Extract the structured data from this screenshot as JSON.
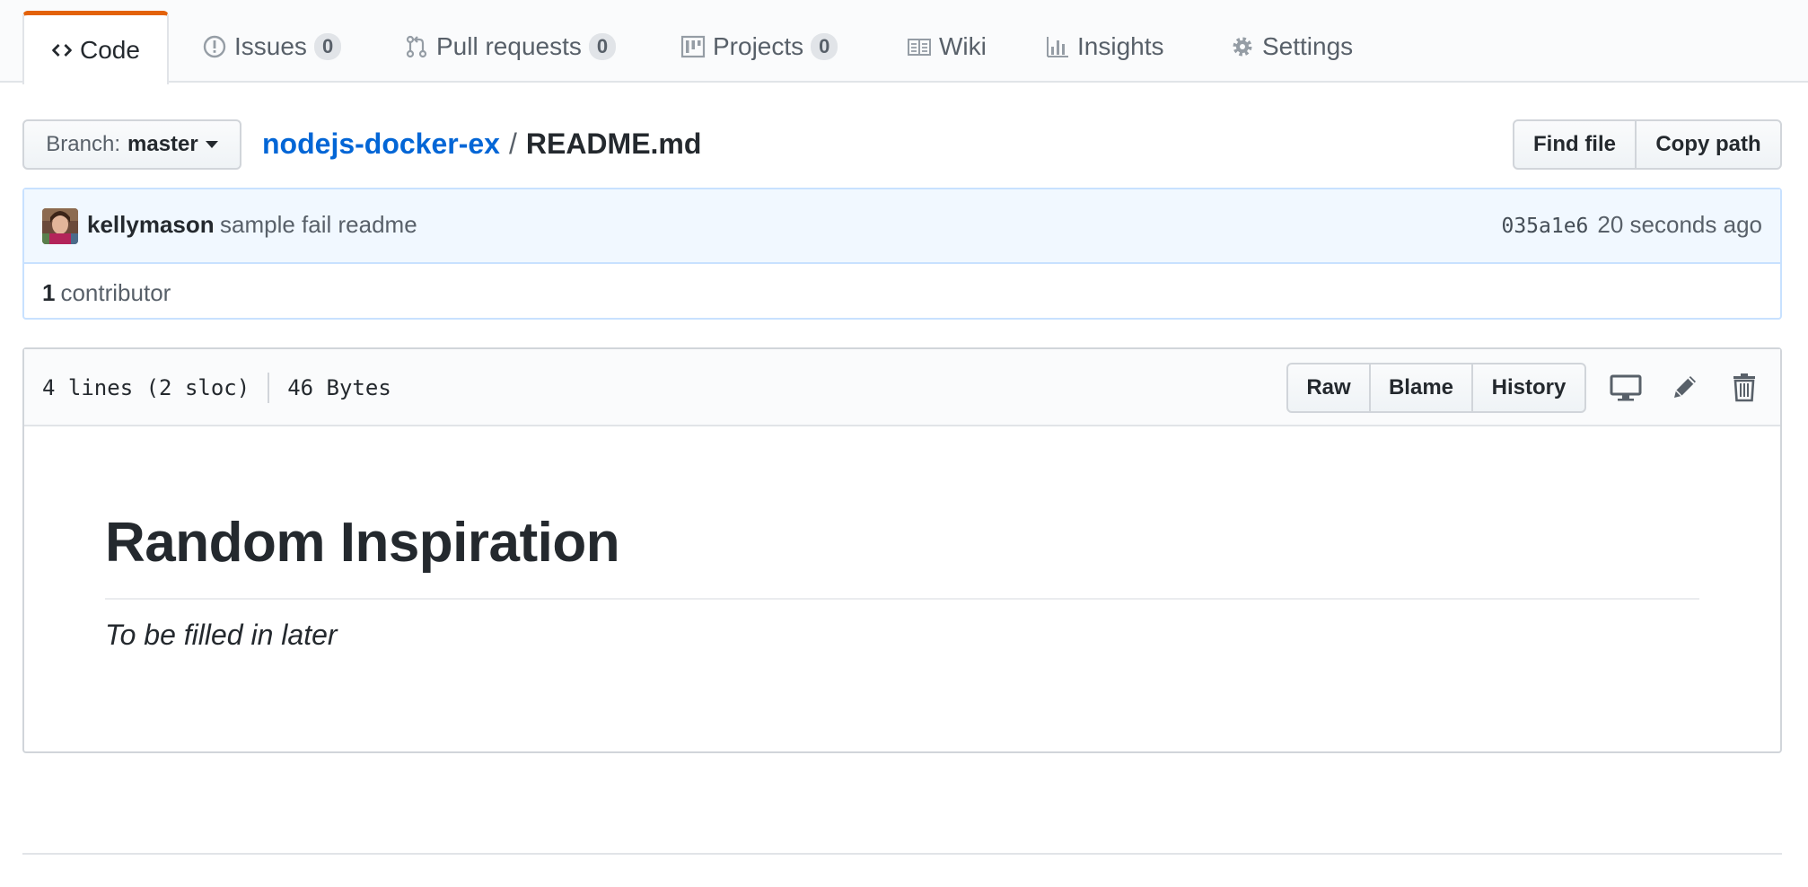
{
  "tabs": [
    {
      "id": "code",
      "label": "Code",
      "icon": "code-icon",
      "selected": true
    },
    {
      "id": "issues",
      "label": "Issues",
      "count": "0",
      "icon": "issue-opened-icon"
    },
    {
      "id": "pull_requests",
      "label": "Pull requests",
      "count": "0",
      "icon": "git-pull-request-icon"
    },
    {
      "id": "projects",
      "label": "Projects",
      "count": "0",
      "icon": "project-icon"
    },
    {
      "id": "wiki",
      "label": "Wiki",
      "icon": "book-icon"
    },
    {
      "id": "insights",
      "label": "Insights",
      "icon": "graph-icon"
    },
    {
      "id": "settings",
      "label": "Settings",
      "icon": "gear-icon"
    }
  ],
  "filenav": {
    "branch_prefix": "Branch:",
    "branch": "master",
    "repo": "nodejs-docker-ex",
    "separator": "/",
    "file": "README.md",
    "find_file": "Find file",
    "copy_path": "Copy path"
  },
  "commit": {
    "author": "kellymason",
    "message": "sample fail readme",
    "sha": "035a1e6",
    "time": "20 seconds ago",
    "contributors_count": "1",
    "contributors_label": "contributor"
  },
  "file": {
    "lines": "4 lines (2 sloc)",
    "size": "46 Bytes",
    "raw": "Raw",
    "blame": "Blame",
    "history": "History",
    "icons": [
      "desktop-icon",
      "pencil-icon",
      "trash-icon"
    ]
  },
  "readme": {
    "heading": "Random Inspiration",
    "body": "To be filled in later"
  },
  "colors": {
    "accent_tab": "#e36209",
    "link": "#0366d6",
    "commit_bg": "#f1f8ff",
    "commit_border": "#c8e1ff"
  }
}
